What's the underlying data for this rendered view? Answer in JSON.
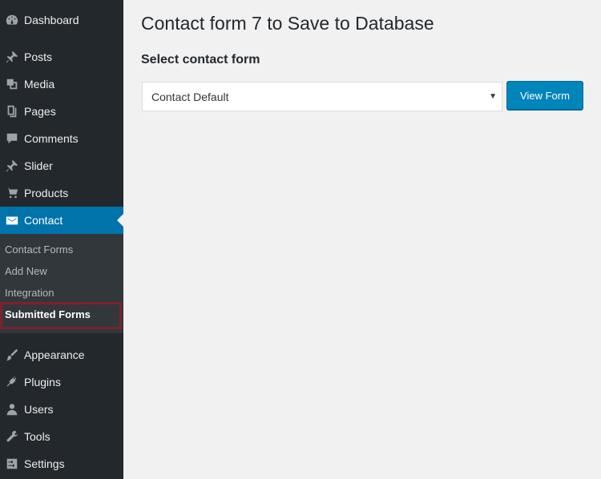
{
  "sidebar": {
    "items": [
      {
        "label": "Dashboard",
        "icon": "dashboard-icon"
      },
      {
        "label": "Posts",
        "icon": "pin-icon"
      },
      {
        "label": "Media",
        "icon": "media-icon"
      },
      {
        "label": "Pages",
        "icon": "pages-icon"
      },
      {
        "label": "Comments",
        "icon": "comment-icon"
      },
      {
        "label": "Slider",
        "icon": "pin-icon"
      },
      {
        "label": "Products",
        "icon": "cart-icon"
      },
      {
        "label": "Contact",
        "icon": "mail-icon",
        "active": true
      },
      {
        "label": "Appearance",
        "icon": "brush-icon"
      },
      {
        "label": "Plugins",
        "icon": "plug-icon"
      },
      {
        "label": "Users",
        "icon": "user-icon"
      },
      {
        "label": "Tools",
        "icon": "wrench-icon"
      },
      {
        "label": "Settings",
        "icon": "settings-icon"
      }
    ],
    "submenu": [
      {
        "label": "Contact Forms"
      },
      {
        "label": "Add New"
      },
      {
        "label": "Integration"
      },
      {
        "label": "Submitted Forms",
        "current": true
      }
    ]
  },
  "main": {
    "title": "Contact form 7 to Save to Database",
    "section_title": "Select contact form",
    "select": {
      "value": "Contact Default"
    },
    "view_button": "View Form"
  },
  "colors": {
    "sidebar_bg": "#23282d",
    "submenu_bg": "#32373c",
    "accent": "#0073aa",
    "button": "#0085ba",
    "highlight": "#7a2230",
    "page_bg": "#f1f1f1"
  }
}
